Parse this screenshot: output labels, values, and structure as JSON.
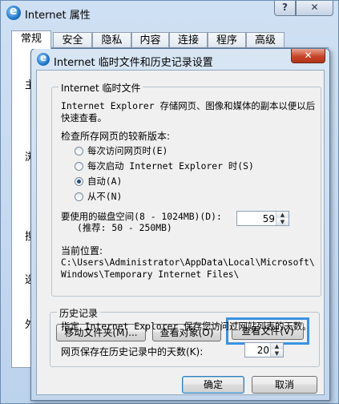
{
  "outer": {
    "title": "Internet 属性",
    "help_label": "?",
    "close_label": "✕",
    "tabs": [
      "常规",
      "安全",
      "隐私",
      "内容",
      "连接",
      "程序",
      "高级"
    ],
    "peek_chars": [
      "主",
      "浏",
      "搜",
      "选",
      "外"
    ]
  },
  "dialog": {
    "title": "Internet 临时文件和历史记录设置",
    "close_label": "✕",
    "temp_group": {
      "label": "Internet 临时文件",
      "description_line1": "Internet Explorer 存储网页、图像和媒体的副本以便以后",
      "description_line2": "快速查看。",
      "check_label": "检查所存网页的较新版本:",
      "options": [
        {
          "label": "每次访问网页时(E)",
          "checked": false
        },
        {
          "label": "每次启动 Internet Explorer 时(S)",
          "checked": false
        },
        {
          "label": "自动(A)",
          "checked": true
        },
        {
          "label": "从不(N)",
          "checked": false
        }
      ],
      "disk_label_line1": "要使用的磁盘空间(8 - 1024MB)(D):",
      "disk_label_line2": "(推荐: 50 - 250MB)",
      "disk_value": "59",
      "location_label": "当前位置:",
      "location_line1": "C:\\Users\\Administrator\\AppData\\Local\\Microsoft\\",
      "location_line2": "Windows\\Temporary Internet Files\\",
      "buttons": {
        "move_folder": "移动文件夹(M)...",
        "view_objects": "查看对象(O)",
        "view_files": "查看文件(V)"
      }
    },
    "history_group": {
      "label": "历史记录",
      "description": "指定 Internet Explorer 保存您访问过网站列表的天数。",
      "days_label": "网页保存在历史记录中的天数(K):",
      "days_value": "20"
    },
    "ok_label": "确定",
    "cancel_label": "取消"
  }
}
